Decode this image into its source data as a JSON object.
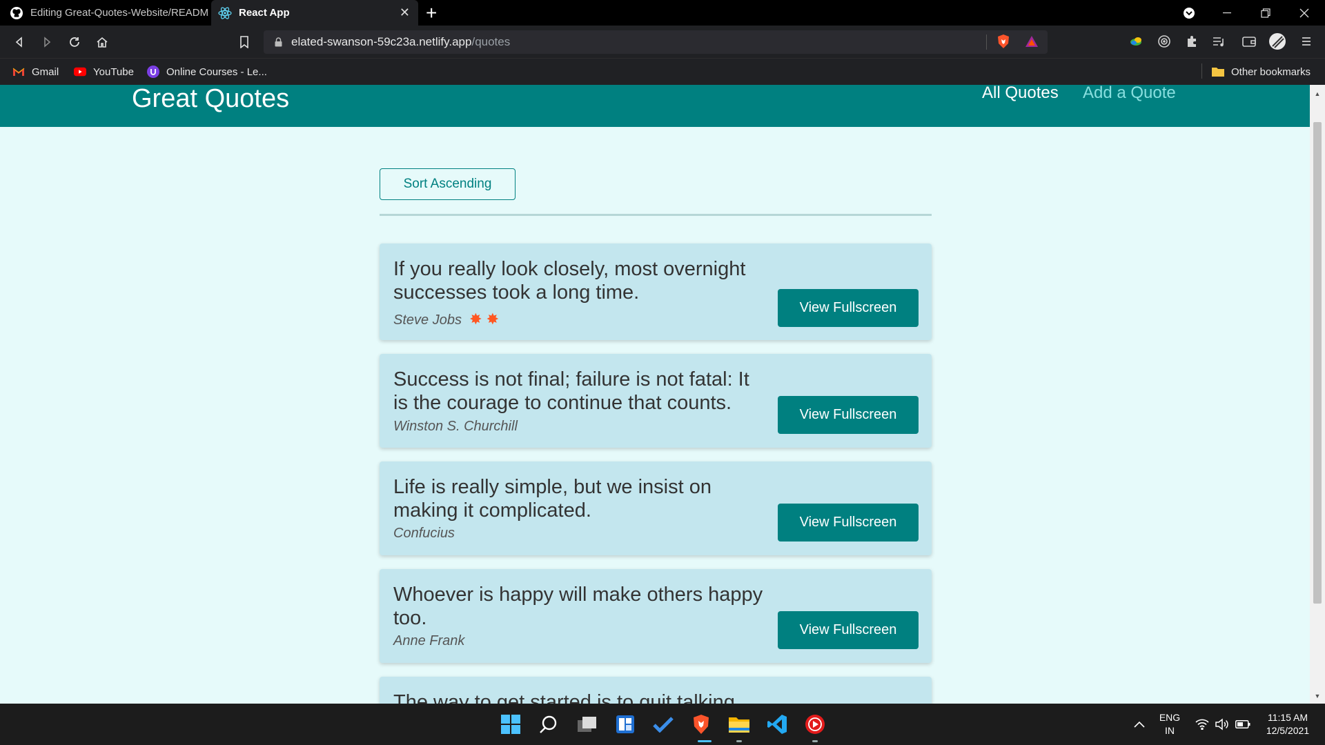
{
  "browser": {
    "tabs": [
      {
        "title": "Editing Great-Quotes-Website/READM",
        "icon": "github-icon",
        "active": false
      },
      {
        "title": "React App",
        "icon": "react-icon",
        "active": true
      }
    ],
    "new_tab": "+",
    "address": {
      "host": "elated-swanson-59c23a.netlify.app",
      "path": "/quotes"
    },
    "bookmarks": [
      {
        "label": "Gmail",
        "icon": "gmail-icon"
      },
      {
        "label": "YouTube",
        "icon": "youtube-icon"
      },
      {
        "label": "Online Courses - Le...",
        "icon": "courses-icon"
      }
    ],
    "other_bookmarks": "Other bookmarks"
  },
  "page": {
    "logo": "Great Quotes",
    "nav": [
      {
        "label": "All Quotes",
        "active": true
      },
      {
        "label": "Add a Quote",
        "active": false
      }
    ],
    "sort_button": "Sort Ascending",
    "view_button_label": "View Fullscreen",
    "quotes": [
      {
        "text": "If you really look closely, most overnight successes took a long time.",
        "author": "Steve Jobs",
        "decoration": "✸ ✸"
      },
      {
        "text": "Success is not final; failure is not fatal: It is the courage to continue that counts.",
        "author": "Winston S. Churchill"
      },
      {
        "text": "Life is really simple, but we insist on making it complicated.",
        "author": "Confucius"
      },
      {
        "text": "Whoever is happy will make others happy too.",
        "author": "Anne Frank"
      },
      {
        "text": "The way to get started is to quit talking",
        "author": ""
      }
    ]
  },
  "taskbar": {
    "apps": [
      "windows-start-icon",
      "search-icon",
      "task-view-icon",
      "widgets-icon",
      "todo-icon",
      "brave-icon",
      "file-explorer-icon",
      "vscode-icon",
      "media-player-icon"
    ],
    "lang": "ENG",
    "region": "IN",
    "time": "11:15 AM",
    "date": "12/5/2021"
  },
  "colors": {
    "header": "#008080",
    "page_bg": "#e6fafa",
    "card_bg": "#c3e6ee",
    "nav_inactive": "#88dfdf"
  }
}
